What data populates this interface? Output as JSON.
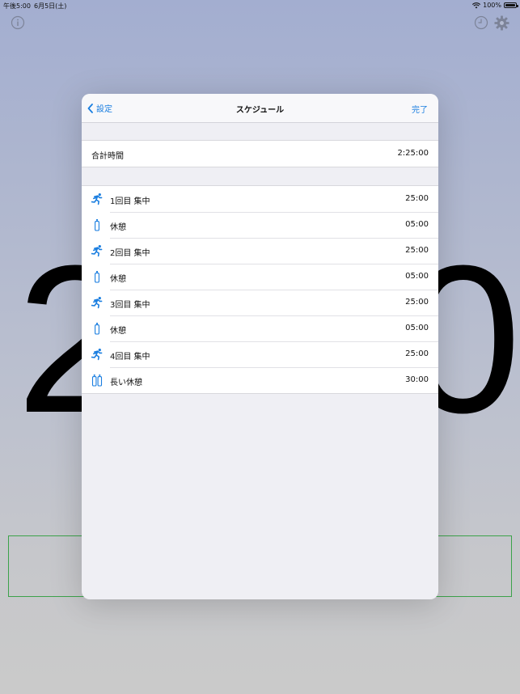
{
  "status_bar": {
    "time": "午後5:00",
    "date": "6月5日(土)",
    "battery_text": "100%"
  },
  "background": {
    "digit_left": "2",
    "digit_right": "0"
  },
  "modal": {
    "back_label": "設定",
    "title": "スケジュール",
    "done_label": "完了",
    "total": {
      "label": "合計時間",
      "value": "2:25:00"
    },
    "items": [
      {
        "icon": "runner-icon",
        "label": "1回目 集中",
        "value": "25:00"
      },
      {
        "icon": "bottle-icon",
        "label": "休憩",
        "value": "05:00"
      },
      {
        "icon": "runner-icon",
        "label": "2回目 集中",
        "value": "25:00"
      },
      {
        "icon": "bottle-icon",
        "label": "休憩",
        "value": "05:00"
      },
      {
        "icon": "runner-icon",
        "label": "3回目 集中",
        "value": "25:00"
      },
      {
        "icon": "bottle-icon",
        "label": "休憩",
        "value": "05:00"
      },
      {
        "icon": "runner-icon",
        "label": "4回目 集中",
        "value": "25:00"
      },
      {
        "icon": "two-bottles-icon",
        "label": "長い休憩",
        "value": "30:00"
      }
    ]
  },
  "colors": {
    "accent": "#1a7ee0",
    "box_border": "#3ca24a"
  }
}
